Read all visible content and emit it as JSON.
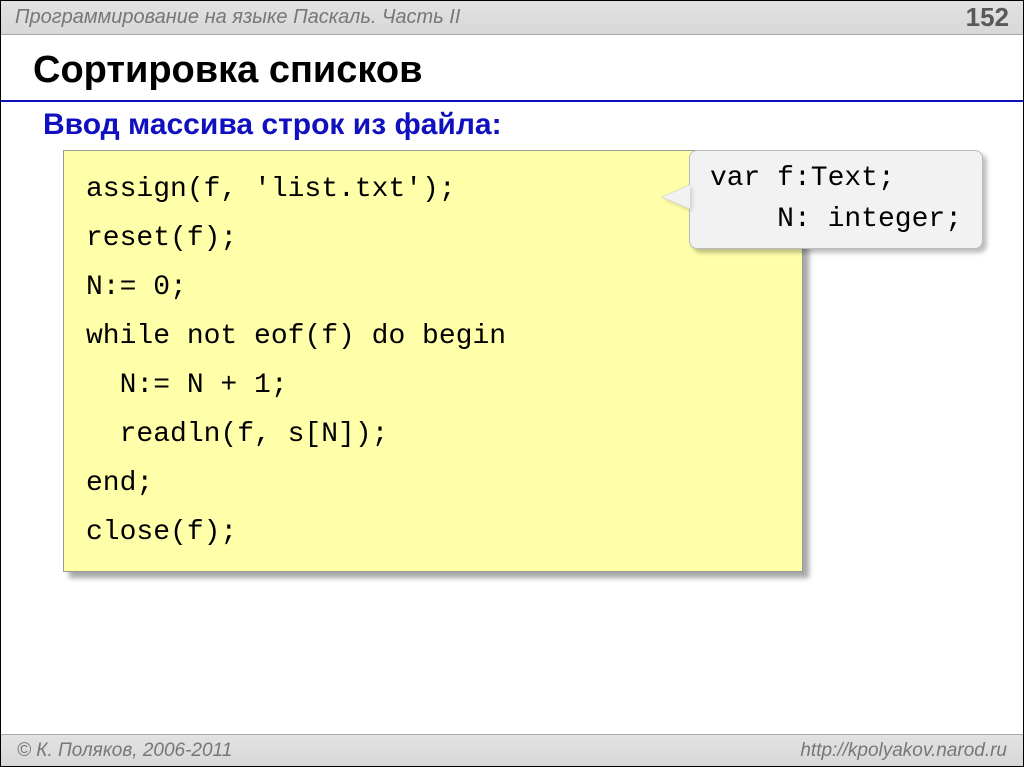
{
  "header": {
    "breadcrumb": "Программирование на языке Паскаль. Часть II",
    "page_number": "152"
  },
  "title": "Сортировка списков",
  "subtitle": "Ввод массива строк из файла:",
  "code": {
    "lines": [
      "assign(f, 'list.txt');",
      "reset(f);",
      "N:= 0;",
      "while not eof(f) do begin",
      "  N:= N + 1;",
      "  readln(f, s[N]);",
      "end;",
      "close(f);"
    ]
  },
  "callout": {
    "line1": "var f:Text;",
    "line2": "    N: integer;"
  },
  "footer": {
    "copyright": "© К. Поляков, 2006-2011",
    "url": "http://kpolyakov.narod.ru"
  }
}
